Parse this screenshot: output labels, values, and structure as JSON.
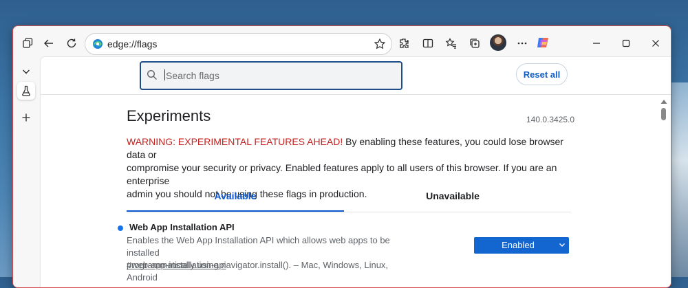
{
  "browser": {
    "address": "edge://flags",
    "colors": {
      "accent": "#0b57d0",
      "window_border": "#d84a4a",
      "select_bg": "#1366d0",
      "warning": "#c5221f"
    }
  },
  "toolbar": {
    "icons": [
      "workspaces-icon",
      "back-icon",
      "refresh-icon",
      "favorite-star-icon",
      "extensions-icon",
      "split-screen-icon",
      "favorites-icon",
      "collections-icon",
      "profile-avatar",
      "more-icon",
      "copilot-icon",
      "minimize-icon",
      "maximize-icon",
      "close-icon"
    ]
  },
  "sidebar": {
    "icons": [
      "collapse-chevron-icon",
      "flask-icon",
      "add-icon"
    ]
  },
  "search": {
    "placeholder": "Search flags",
    "value": ""
  },
  "reset_label": "Reset all",
  "page": {
    "title": "Experiments",
    "version": "140.0.3425.0",
    "warning_strong": "WARNING: EXPERIMENTAL FEATURES AHEAD!",
    "warning_line1_rest": " By enabling these features, you could lose browser data or",
    "warning_line2": "compromise your security or privacy. Enabled features apply to all users of this browser. If you are an enterprise",
    "warning_line3": "admin you should not be using these flags in production."
  },
  "tabs": [
    {
      "label": "Available",
      "selected": true
    },
    {
      "label": "Unavailable",
      "selected": false
    }
  ],
  "flags": [
    {
      "title": "Web App Installation API",
      "desc_line1": "Enables the Web App Installation API which allows web apps to be installed",
      "desc_line2": "programmatically using navigator.install(). – Mac, Windows, Linux, Android",
      "link": "#web-app-installation-api",
      "state": "Enabled"
    }
  ]
}
